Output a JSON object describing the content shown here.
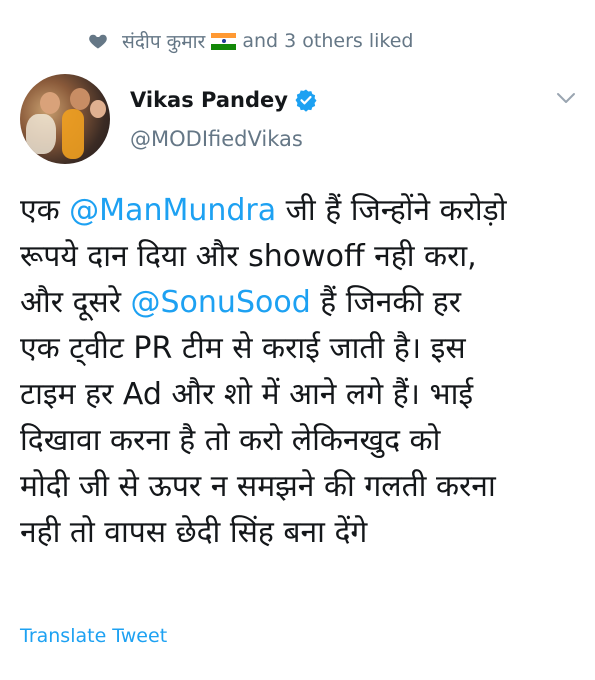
{
  "social_context": {
    "liker_name": "संदीप कुमार",
    "flag_emoji": "india-flag",
    "others_text": "and 3 others liked",
    "icon": "heart-icon"
  },
  "author": {
    "display_name": "Vikas Pandey",
    "handle": "@MODIfiedVikas",
    "verified": true,
    "verified_color": "#1da1f2"
  },
  "tweet": {
    "lines": [
      {
        "before": "एक ",
        "mention": "@ManMundra",
        "after": " जी हैं जिन्होंने करोड़ो"
      },
      {
        "before": "रूपये दान दिया और showoff नही करा,",
        "mention": "",
        "after": ""
      },
      {
        "before": "और दूसरे ",
        "mention": "@SonuSood",
        "after": " हैं जिनकी हर"
      },
      {
        "before": "एक ट्वीट PR टीम से कराई जाती है। इस",
        "mention": "",
        "after": ""
      },
      {
        "before": "टाइम हर Ad और शो में आने लगे हैं। भाई",
        "mention": "",
        "after": ""
      },
      {
        "before": "दिखावा करना है तो करो लेकिनखुद को",
        "mention": "",
        "after": ""
      },
      {
        "before": "मोदी जी से ऊपर न समझने की गलती करना",
        "mention": "",
        "after": ""
      },
      {
        "before": "नही तो वापस छेदी सिंह बना देंगे",
        "mention": "",
        "after": ""
      }
    ]
  },
  "translate_label": "Translate Tweet",
  "colors": {
    "link": "#1da1f2",
    "secondary_text": "#657786",
    "primary_text": "#14171a"
  }
}
